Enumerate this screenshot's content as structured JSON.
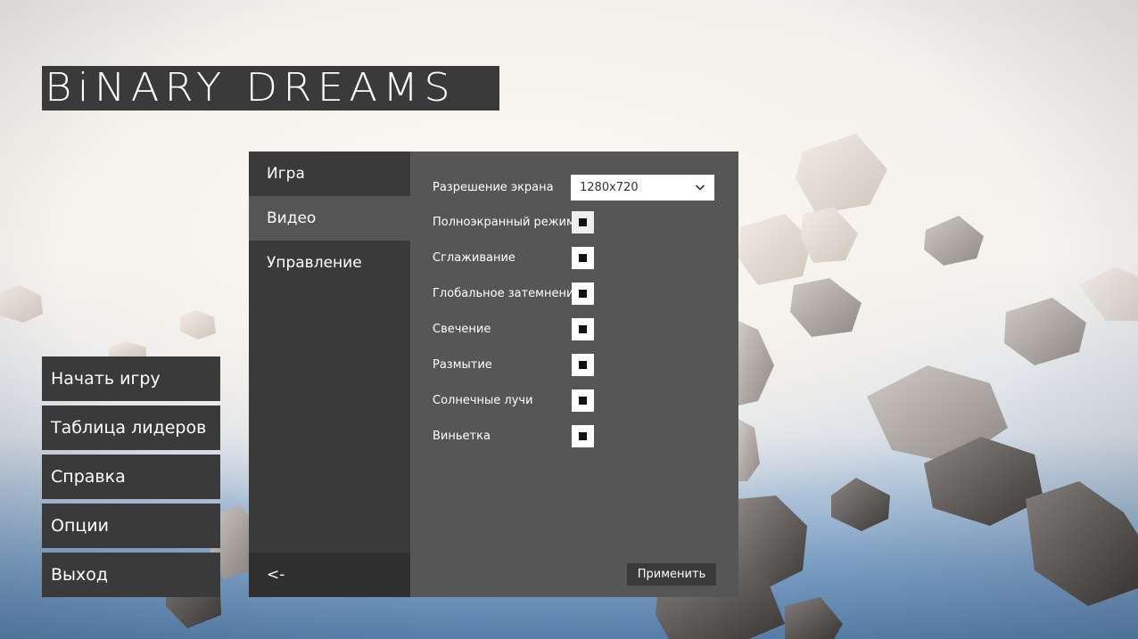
{
  "game": {
    "title": "BiNARY DREAMS"
  },
  "main_menu": {
    "items": [
      {
        "label": "Начать игру"
      },
      {
        "label": "Таблица лидеров"
      },
      {
        "label": "Справка"
      },
      {
        "label": "Опции"
      },
      {
        "label": "Выход"
      }
    ]
  },
  "options": {
    "tabs": [
      {
        "label": "Игра",
        "active": false
      },
      {
        "label": "Видео",
        "active": true
      },
      {
        "label": "Управление",
        "active": false
      }
    ],
    "back_label": "<-",
    "resolution": {
      "label": "Разрешение экрана",
      "value": "1280x720",
      "icon": "chevron-down-icon"
    },
    "toggles": [
      {
        "label": "Полноэкранный режим",
        "checked": true
      },
      {
        "label": "Сглаживание",
        "checked": true
      },
      {
        "label": "Глобальное затемнение",
        "checked": true
      },
      {
        "label": "Свечение",
        "checked": true
      },
      {
        "label": "Размытие",
        "checked": true
      },
      {
        "label": "Солнечные лучи",
        "checked": true
      },
      {
        "label": "Виньетка",
        "checked": true
      }
    ],
    "apply_label": "Применить"
  },
  "colors": {
    "panel_dark": "#3a3a3a",
    "panel_mid": "#565656",
    "tab_active": "#555555",
    "checkbox_bg": "#ffffff"
  }
}
